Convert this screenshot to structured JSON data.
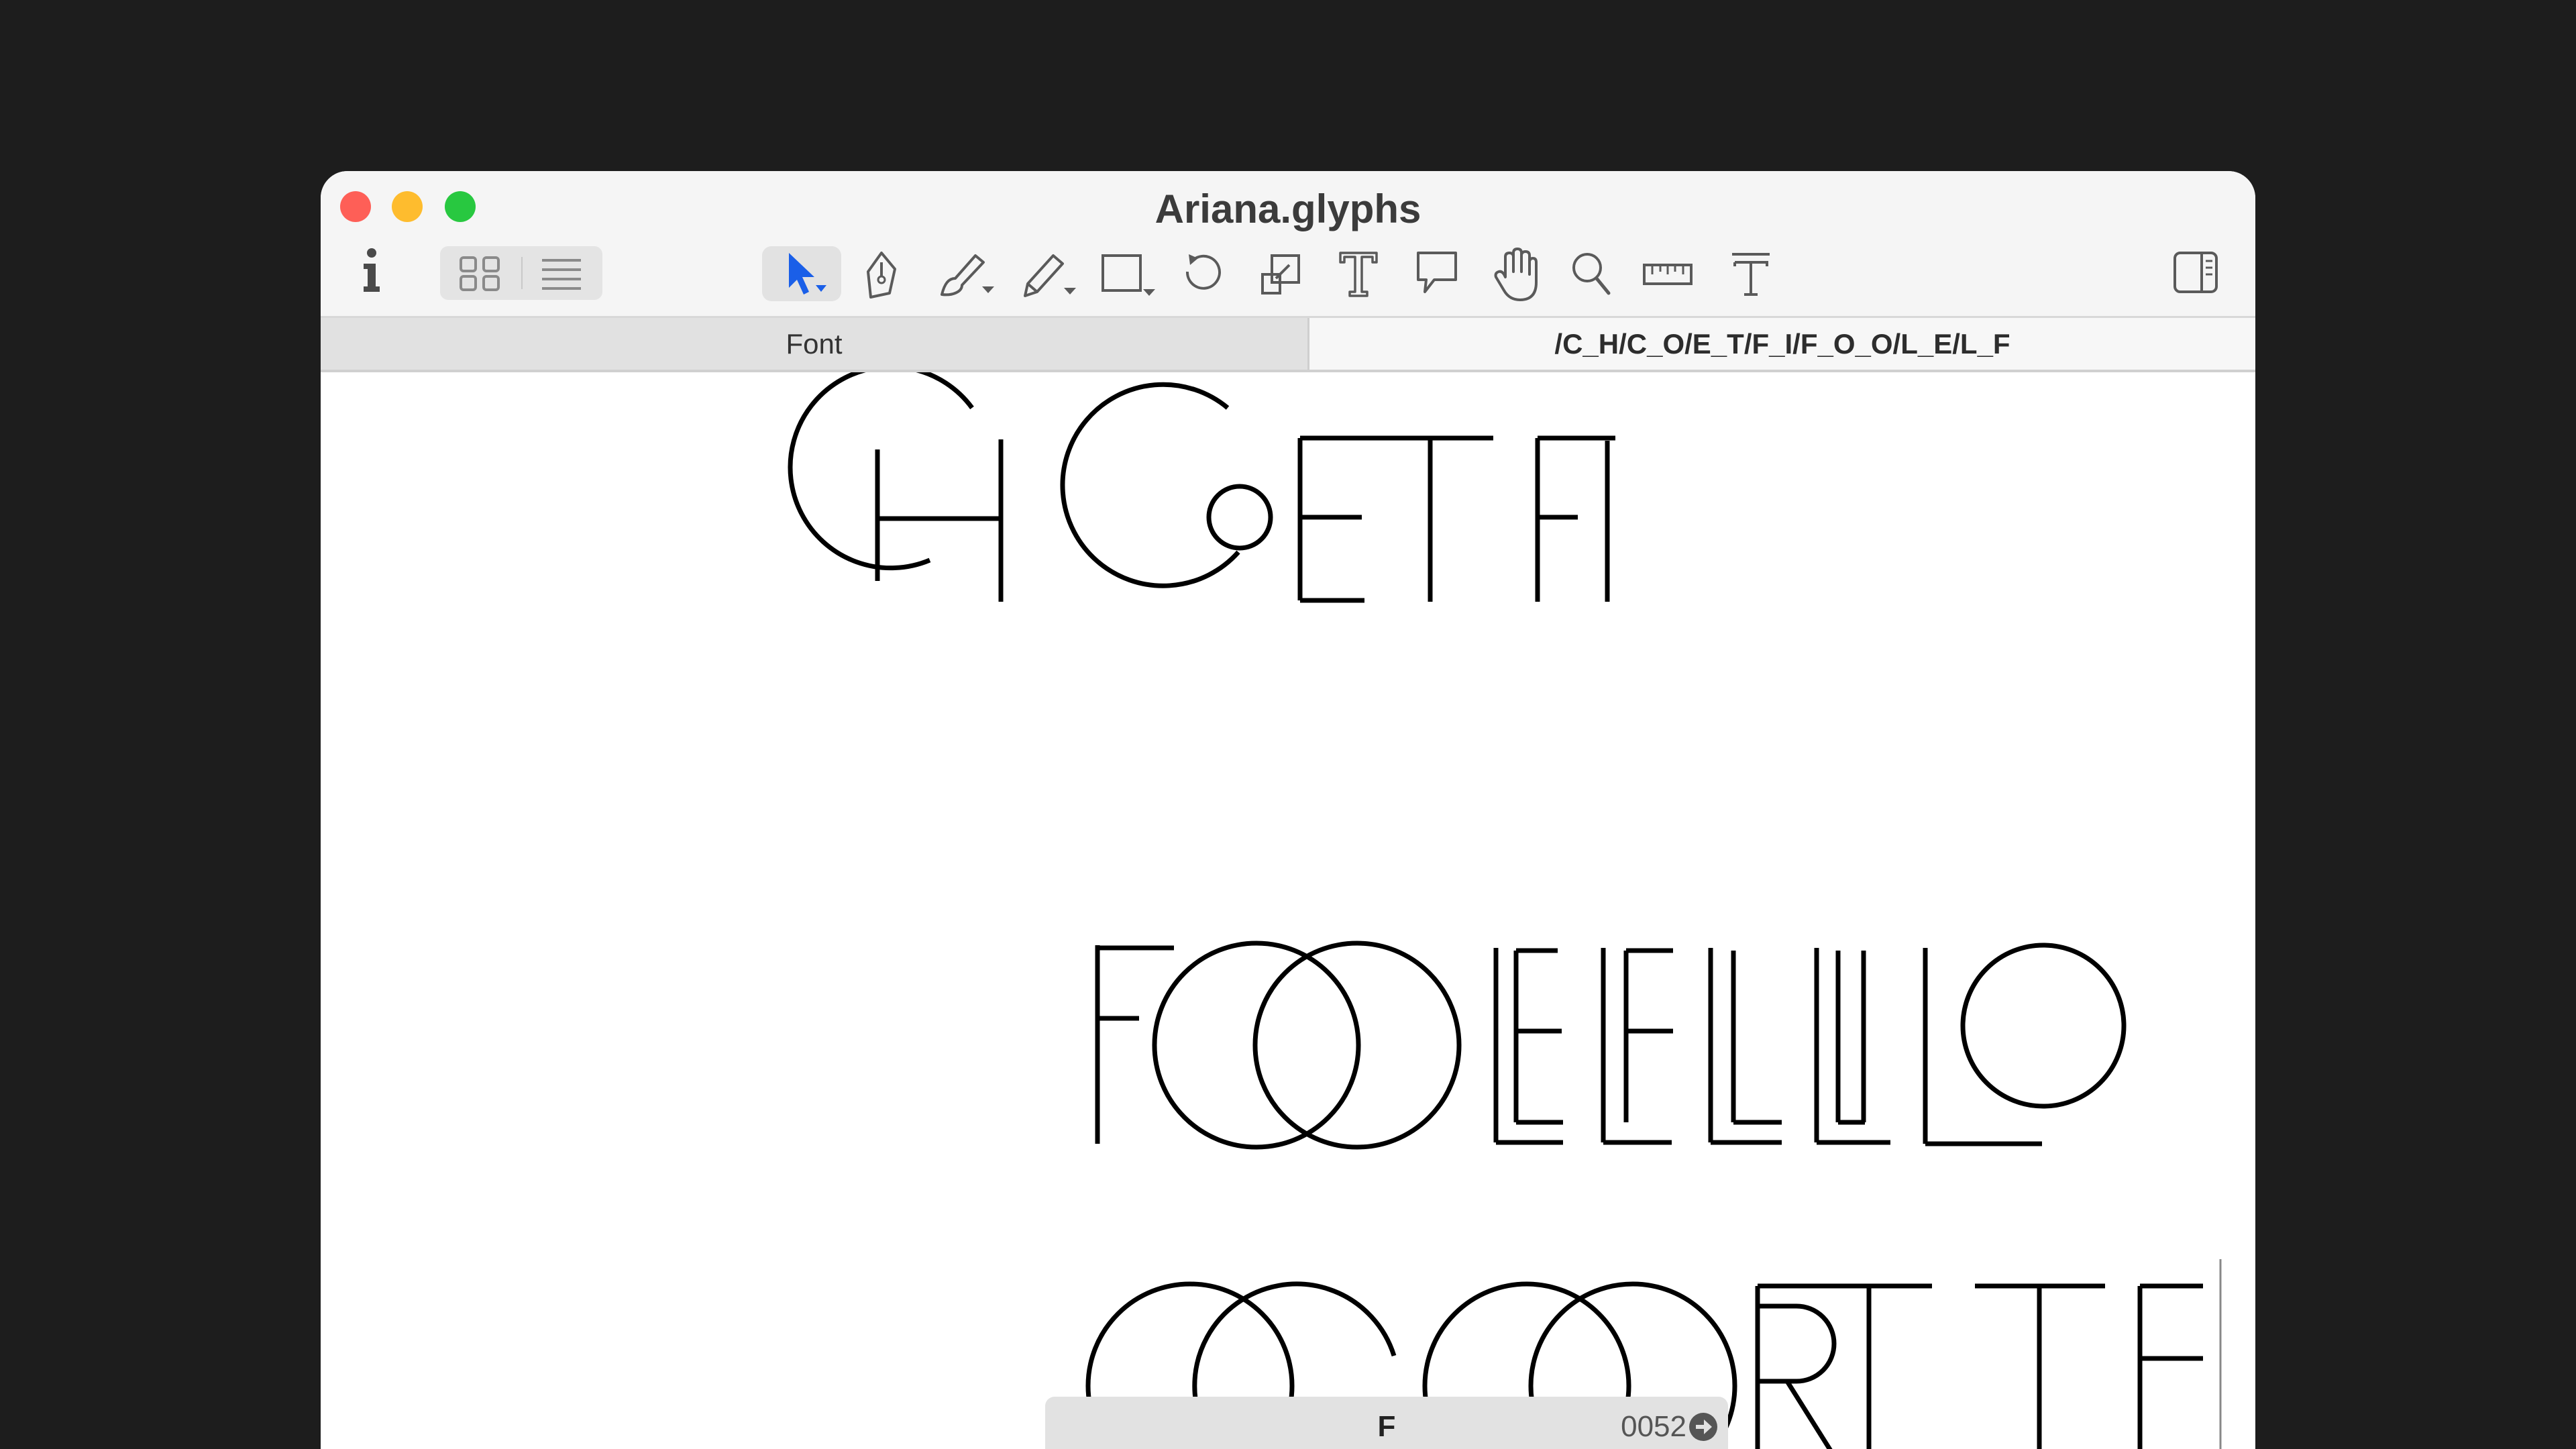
{
  "window": {
    "title": "Ariana.glyphs"
  },
  "tabs": [
    {
      "label": "Font"
    },
    {
      "label": "/C_H/C_O/E_T/F_I/F_O_O/L_E/L_F"
    }
  ],
  "toolbar": {
    "tools": [
      "info-icon",
      "grid-view-icon",
      "list-view-icon",
      "select-tool-icon",
      "pen-tool-icon",
      "brush-tool-icon",
      "pencil-tool-icon",
      "rectangle-tool-icon",
      "rotate-tool-icon",
      "scale-tool-icon",
      "text-tool-icon",
      "annotation-tool-icon",
      "hand-tool-icon",
      "zoom-tool-icon",
      "measure-tool-icon",
      "metrics-tool-icon",
      "sidebar-toggle-icon"
    ]
  },
  "infobar": {
    "glyph": "F",
    "code": "0052"
  },
  "colors": {
    "accent": "#1a5fe8",
    "background": "#1d1d1d",
    "window": "#ffffff",
    "chrome": "#f5f5f5"
  }
}
